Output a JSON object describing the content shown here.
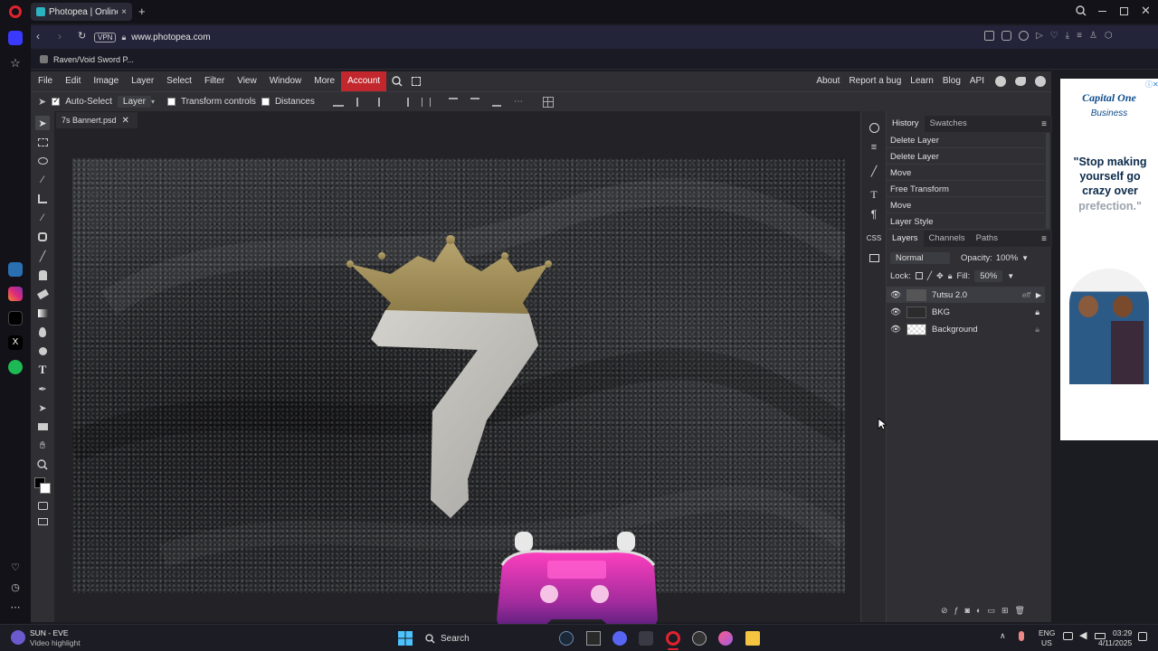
{
  "browser": {
    "tab_title": "Photopea | Online Photo",
    "url": "www.photopea.com",
    "vpn_badge": "VPN",
    "bookmark": "Raven/Void Sword P..."
  },
  "menu": {
    "items": [
      "File",
      "Edit",
      "Image",
      "Layer",
      "Select",
      "Filter",
      "View",
      "Window",
      "More",
      "Account"
    ],
    "right_items": [
      "About",
      "Report a bug",
      "Learn",
      "Blog",
      "API"
    ]
  },
  "options": {
    "auto_select_label": "Auto-Select",
    "auto_select_checked": true,
    "layer_select": "Layer",
    "transform_controls_label": "Transform controls",
    "distances_label": "Distances"
  },
  "document": {
    "tab_name": "7s Bannert.psd"
  },
  "history": {
    "tabs": [
      "History",
      "Swatches"
    ],
    "items": [
      "Delete Layer",
      "Delete Layer",
      "Move",
      "Free Transform",
      "Move",
      "Layer Style"
    ]
  },
  "layers": {
    "tabs": [
      "Layers",
      "Channels",
      "Paths"
    ],
    "blend_mode": "Normal",
    "opacity_label": "Opacity:",
    "opacity_value": "100%",
    "lock_label": "Lock:",
    "fill_label": "Fill:",
    "fill_value": "50%",
    "items": [
      {
        "name": "7utsu 2.0",
        "badge": "eff"
      },
      {
        "name": "BKG"
      },
      {
        "name": "Background"
      }
    ]
  },
  "side_panel_labels": {
    "css": "CSS"
  },
  "ad": {
    "brand": "Capital One",
    "sub": "Business",
    "quote_line1": "\"Stop making yourself go crazy over",
    "quote_line2": "prefection.\""
  },
  "taskbar": {
    "media_title": "SUN - EVE",
    "media_sub": "Video highlight",
    "search_label": "Search",
    "lang": "ENG",
    "region": "US",
    "time": "03:29",
    "date": "4/11/2025"
  },
  "colors": {
    "account_bg": "#c1272d",
    "panel_bg": "#2f2f34",
    "crown_gold": "#a89560"
  }
}
